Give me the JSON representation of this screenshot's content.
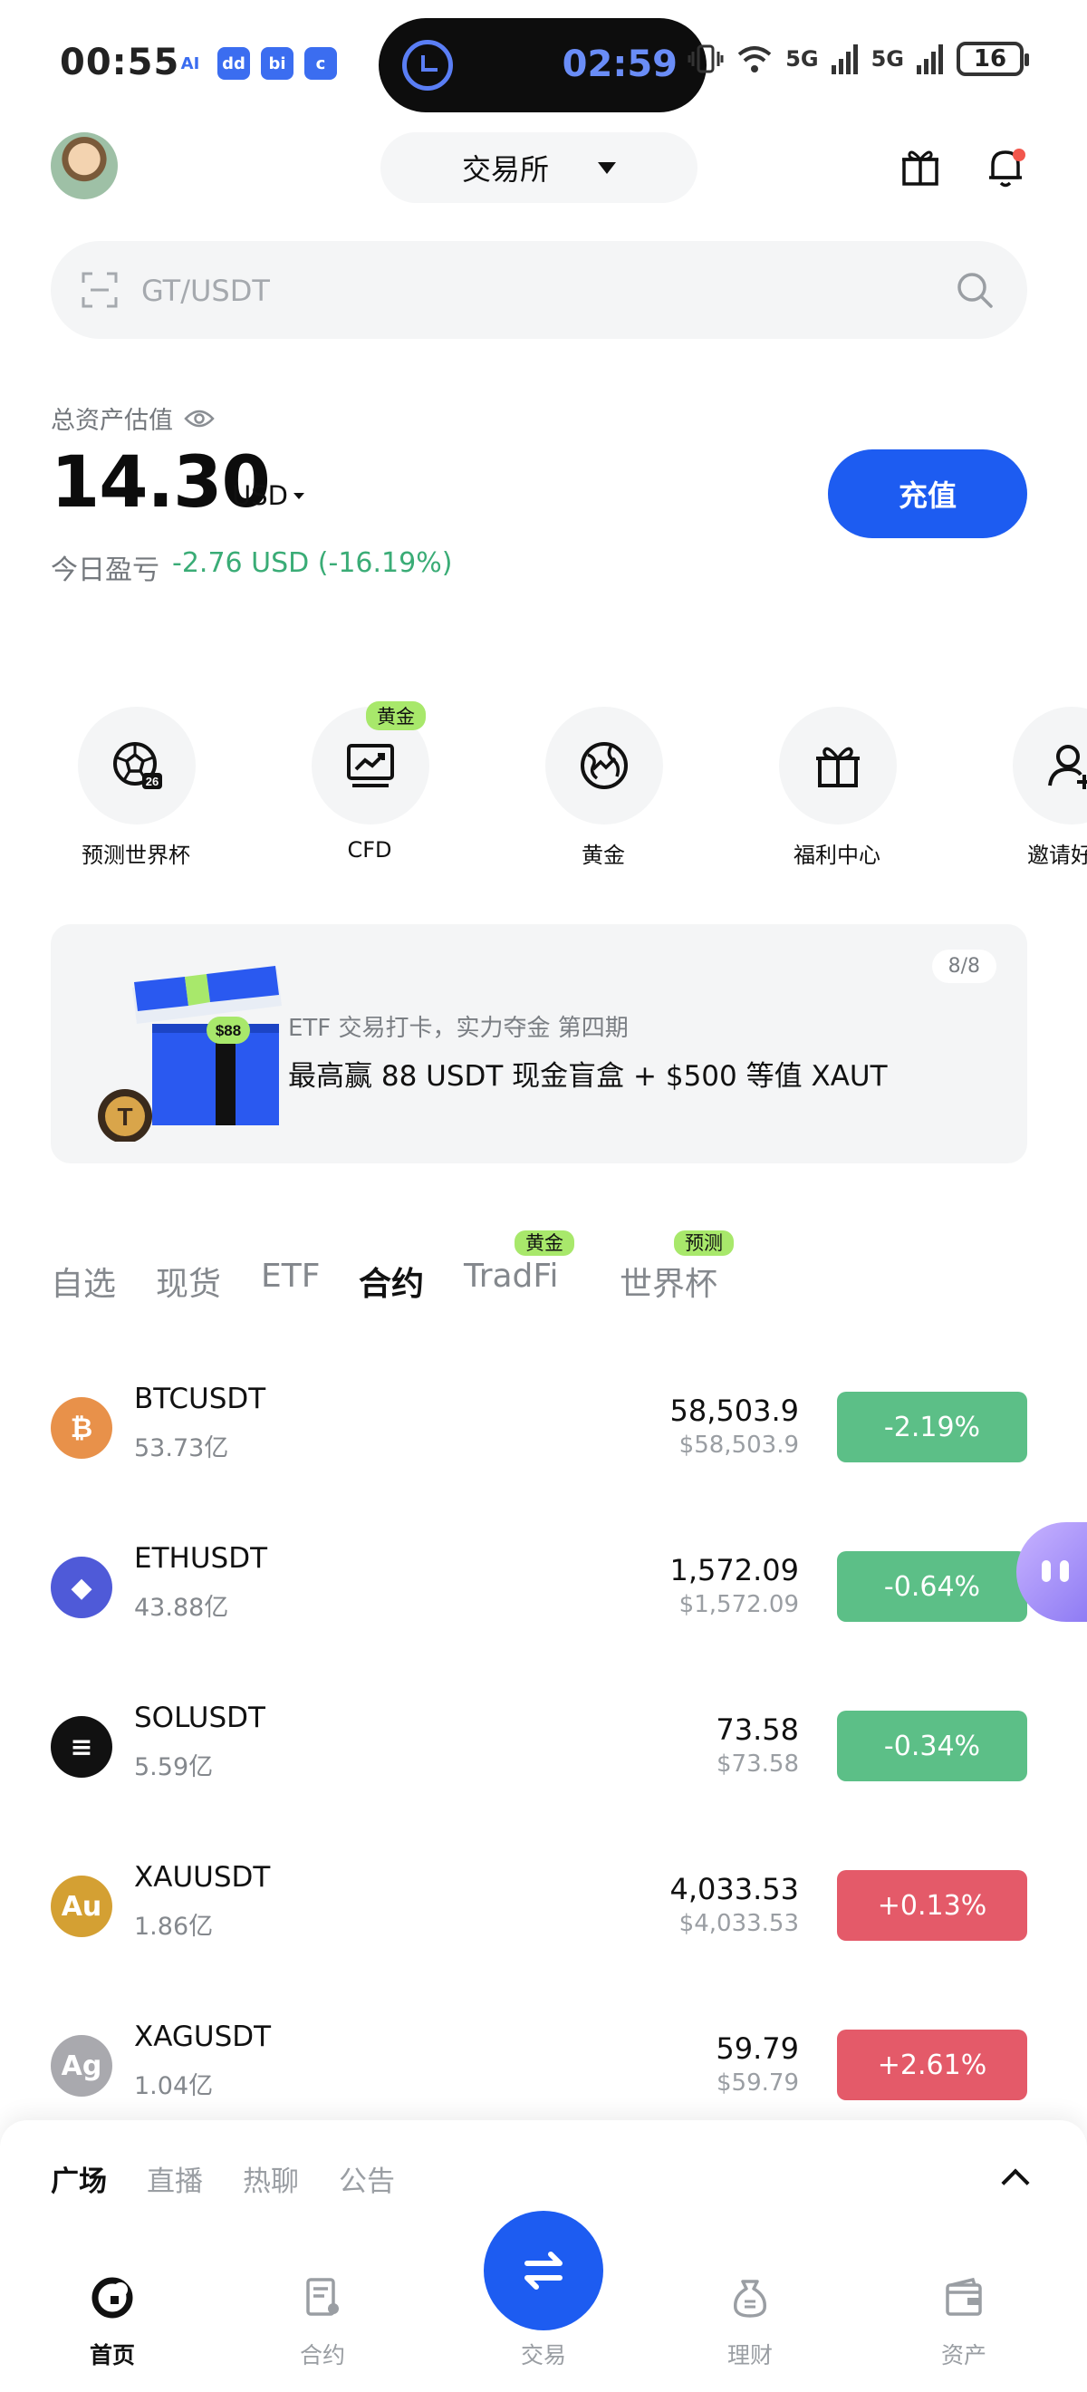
{
  "status_bar": {
    "time": "00:55",
    "app_icons": [
      "AI",
      "dd",
      "bi",
      "c"
    ],
    "island_time": "02:59",
    "network_1": "5G",
    "network_2": "5G",
    "battery": "16"
  },
  "header": {
    "exchange_label": "交易所"
  },
  "search": {
    "placeholder": "GT/USDT"
  },
  "assets": {
    "label": "总资产估值",
    "value": "14.30",
    "currency": "USD",
    "deposit_label": "充值",
    "pnl_label": "今日盈亏",
    "pnl_value": "-2.76 USD (-16.19%)"
  },
  "shortcuts": [
    {
      "label": "预测世界杯",
      "icon": "football-icon",
      "badge": ""
    },
    {
      "label": "CFD",
      "icon": "chart-board-icon",
      "badge": "黄金"
    },
    {
      "label": "黄金",
      "icon": "globe-icon",
      "badge": ""
    },
    {
      "label": "福利中心",
      "icon": "gift-icon",
      "badge": ""
    },
    {
      "label": "邀请好友",
      "icon": "user-add-icon",
      "badge": ""
    }
  ],
  "banner": {
    "subtitle": "ETF 交易打卡，实力夺金 第四期",
    "title": "最高赢 88 USDT 现金盲盒 + $500 等值 XAUT",
    "page": "8/8",
    "art_badge": "$88"
  },
  "market_tabs": [
    {
      "label": "自选",
      "badge": ""
    },
    {
      "label": "现货",
      "badge": ""
    },
    {
      "label": "ETF",
      "badge": ""
    },
    {
      "label": "合约",
      "badge": ""
    },
    {
      "label": "TradFi",
      "badge": "黄金"
    },
    {
      "label": "世界杯",
      "badge": "预测"
    }
  ],
  "market_active_tab": "合约",
  "markets": [
    {
      "symbol": "BTCUSDT",
      "volume": "53.73亿",
      "price": "58,503.9",
      "price_usd": "$58,503.9",
      "change": "-2.19%",
      "direction": "down",
      "icon_text": "₿",
      "icon_color": "#e8914a"
    },
    {
      "symbol": "ETHUSDT",
      "volume": "43.88亿",
      "price": "1,572.09",
      "price_usd": "$1,572.09",
      "change": "-0.64%",
      "direction": "down",
      "icon_text": "◆",
      "icon_color": "#4f5ad8"
    },
    {
      "symbol": "SOLUSDT",
      "volume": "5.59亿",
      "price": "73.58",
      "price_usd": "$73.58",
      "change": "-0.34%",
      "direction": "down",
      "icon_text": "≡",
      "icon_color": "#111111"
    },
    {
      "symbol": "XAUUSDT",
      "volume": "1.86亿",
      "price": "4,033.53",
      "price_usd": "$4,033.53",
      "change": "+0.13%",
      "direction": "up",
      "icon_text": "Au",
      "icon_color": "#d4a033"
    },
    {
      "symbol": "XAGUSDT",
      "volume": "1.04亿",
      "price": "59.79",
      "price_usd": "$59.79",
      "change": "+2.61%",
      "direction": "up",
      "icon_text": "Ag",
      "icon_color": "#a9a9ae"
    }
  ],
  "sheet_tabs": [
    "广场",
    "直播",
    "热聊",
    "公告"
  ],
  "bottom_nav": [
    {
      "label": "首页",
      "icon": "home-icon"
    },
    {
      "label": "合约",
      "icon": "contract-icon"
    },
    {
      "label": "交易",
      "icon": "trade-icon"
    },
    {
      "label": "理财",
      "icon": "wealth-icon"
    },
    {
      "label": "资产",
      "icon": "wallet-icon"
    }
  ],
  "colors": {
    "accent": "#1d5cf1",
    "positive": "#3aac76",
    "down_pill": "#5cbf87",
    "up_pill": "#e45a69",
    "badge": "#a8e86b"
  }
}
